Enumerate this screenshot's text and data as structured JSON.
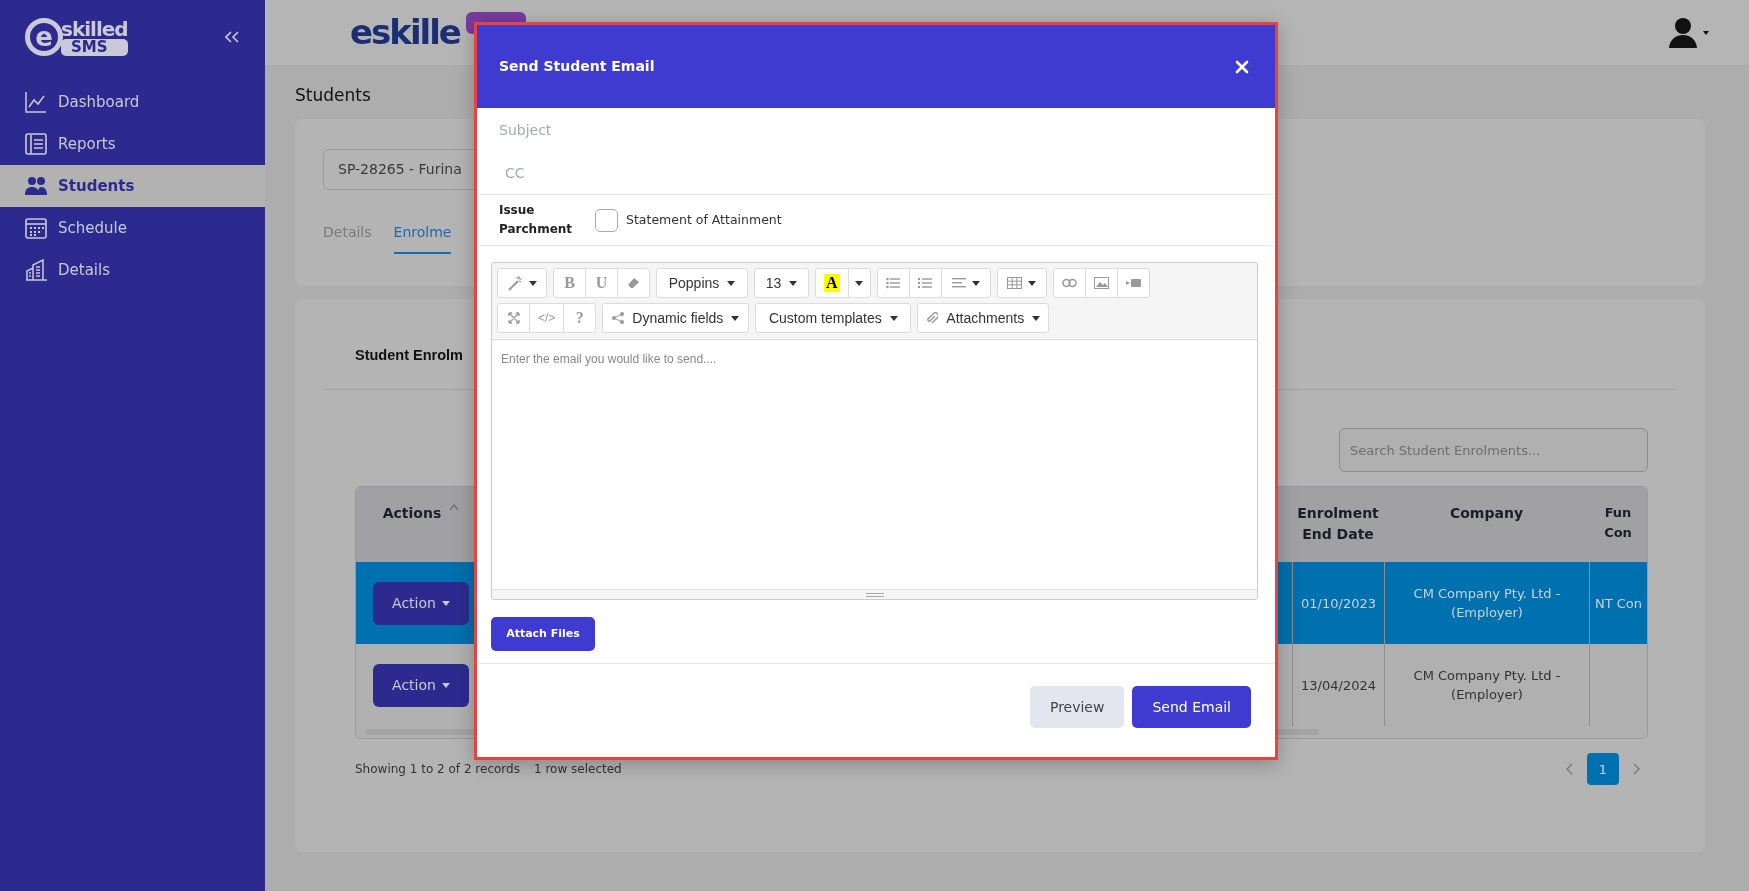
{
  "sidebar": {
    "logo": {
      "mark": "e",
      "word": "skilled",
      "badge": "SMS"
    },
    "items": [
      {
        "label": "Dashboard",
        "selected": false
      },
      {
        "label": "Reports",
        "selected": false
      },
      {
        "label": "Students",
        "selected": true
      },
      {
        "label": "Schedule",
        "selected": false
      },
      {
        "label": "Details",
        "selected": false
      }
    ]
  },
  "header": {
    "logo": "eskille"
  },
  "page": {
    "title": "Students",
    "student_select": {
      "value": "SP-28265 - Furina"
    },
    "tabs": [
      {
        "label": "Details",
        "selected": false
      },
      {
        "label": "Enrolme",
        "selected": true
      }
    ]
  },
  "enrolments": {
    "title": "Student Enrolm",
    "search": {
      "placeholder": "Search Student Enrolments..."
    },
    "table": {
      "columns": [
        "Actions",
        "Enrolment End Date",
        "Company",
        "Fun Con"
      ],
      "rows": [
        {
          "selected": true,
          "action": "Action",
          "end_date": "01/10/2023",
          "company": "CM Company Pty. Ltd - (Employer)",
          "column_4": "NT Con"
        },
        {
          "selected": false,
          "action": "Action",
          "end_date": "13/04/2024",
          "company": "CM Company Pty. Ltd - (Employer)",
          "column_4": ""
        }
      ]
    },
    "summary": "Showing 1 to 2 of 2 records",
    "selection": "1 row selected",
    "pages": [
      {
        "label": "1",
        "selected": true
      }
    ]
  },
  "modal": {
    "title": "Send Student Email",
    "subject": {
      "placeholder": "Subject"
    },
    "cc": {
      "placeholder": "CC"
    },
    "parchment_label": "Issue Parchment",
    "parchment_options": [
      {
        "label": "Statement of Attainment",
        "checked": false
      }
    ],
    "toolbar": {
      "text_buttons": [
        "B",
        "U",
        "A",
        "</>",
        "?"
      ],
      "dropdowns": [
        "Poppins",
        "13",
        "Dynamic fields",
        "Custom templates",
        "Attachments"
      ]
    },
    "editor": {
      "placeholder": "Enter the email you would like to send...."
    },
    "attach_button": "Attach Files",
    "buttons": [
      {
        "label": "Preview",
        "kind": "secondary"
      },
      {
        "label": "Send Email",
        "kind": "primary"
      }
    ]
  }
}
